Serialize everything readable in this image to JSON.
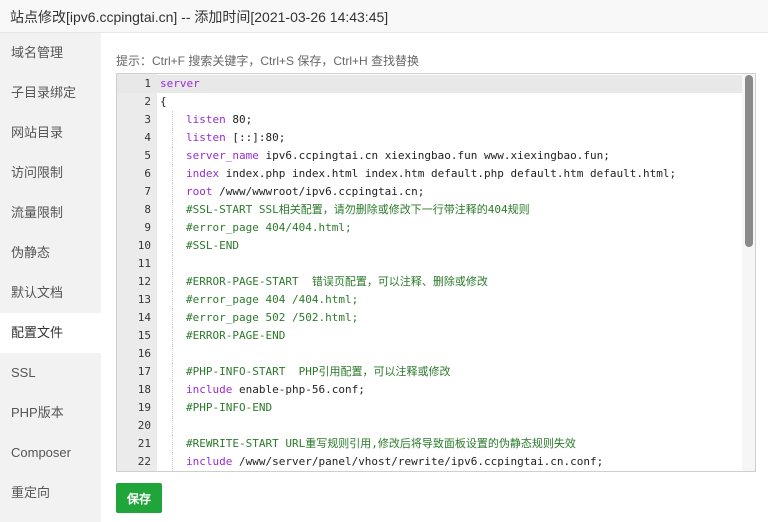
{
  "window": {
    "title": "站点修改[ipv6.ccpingtai.cn] -- 添加时间[2021-03-26 14:43:45]"
  },
  "sidebar": {
    "items": [
      {
        "label": "域名管理"
      },
      {
        "label": "子目录绑定"
      },
      {
        "label": "网站目录"
      },
      {
        "label": "访问限制"
      },
      {
        "label": "流量限制"
      },
      {
        "label": "伪静态"
      },
      {
        "label": "默认文档"
      },
      {
        "label": "配置文件",
        "active": true
      },
      {
        "label": "SSL"
      },
      {
        "label": "PHP版本"
      },
      {
        "label": "Composer"
      },
      {
        "label": "重定向"
      }
    ]
  },
  "hint": "提示：Ctrl+F 搜索关键字，Ctrl+S 保存，Ctrl+H 查找替换",
  "editor": {
    "lines": [
      {
        "n": "1",
        "indent": 0,
        "tokens": [
          {
            "t": "server",
            "c": "kw"
          }
        ]
      },
      {
        "n": "2",
        "indent": 0,
        "tokens": [
          {
            "t": "{",
            "c": "plain"
          }
        ]
      },
      {
        "n": "3",
        "indent": 1,
        "tokens": [
          {
            "t": "listen",
            "c": "kw"
          },
          {
            "t": " 80;",
            "c": "plain"
          }
        ]
      },
      {
        "n": "4",
        "indent": 1,
        "tokens": [
          {
            "t": "listen",
            "c": "kw"
          },
          {
            "t": " [::]:80;",
            "c": "plain"
          }
        ]
      },
      {
        "n": "5",
        "indent": 1,
        "tokens": [
          {
            "t": "server_name",
            "c": "kw"
          },
          {
            "t": " ipv6.ccpingtai.cn xiexingbao.fun www.xiexingbao.fun;",
            "c": "plain"
          }
        ]
      },
      {
        "n": "6",
        "indent": 1,
        "tokens": [
          {
            "t": "index",
            "c": "kw"
          },
          {
            "t": " index.php index.html index.htm default.php default.htm default.html;",
            "c": "plain"
          }
        ]
      },
      {
        "n": "7",
        "indent": 1,
        "tokens": [
          {
            "t": "root",
            "c": "kw"
          },
          {
            "t": " /www/wwwroot/ipv6.ccpingtai.cn;",
            "c": "plain"
          }
        ]
      },
      {
        "n": "8",
        "indent": 1,
        "tokens": [
          {
            "t": "#SSL-START SSL相关配置，请勿删除或修改下一行带注释的404规则",
            "c": "comment"
          }
        ]
      },
      {
        "n": "9",
        "indent": 1,
        "tokens": [
          {
            "t": "#error_page 404/404.html;",
            "c": "comment"
          }
        ]
      },
      {
        "n": "10",
        "indent": 1,
        "tokens": [
          {
            "t": "#SSL-END",
            "c": "comment"
          }
        ]
      },
      {
        "n": "11",
        "indent": 1,
        "tokens": []
      },
      {
        "n": "12",
        "indent": 1,
        "tokens": [
          {
            "t": "#ERROR-PAGE-START  错误页配置，可以注释、删除或修改",
            "c": "comment"
          }
        ]
      },
      {
        "n": "13",
        "indent": 1,
        "tokens": [
          {
            "t": "#error_page 404 /404.html;",
            "c": "comment"
          }
        ]
      },
      {
        "n": "14",
        "indent": 1,
        "tokens": [
          {
            "t": "#error_page 502 /502.html;",
            "c": "comment"
          }
        ]
      },
      {
        "n": "15",
        "indent": 1,
        "tokens": [
          {
            "t": "#ERROR-PAGE-END",
            "c": "comment"
          }
        ]
      },
      {
        "n": "16",
        "indent": 1,
        "tokens": []
      },
      {
        "n": "17",
        "indent": 1,
        "tokens": [
          {
            "t": "#PHP-INFO-START  PHP引用配置，可以注释或修改",
            "c": "comment"
          }
        ]
      },
      {
        "n": "18",
        "indent": 1,
        "tokens": [
          {
            "t": "include",
            "c": "kw"
          },
          {
            "t": " enable-php-56.conf;",
            "c": "plain"
          }
        ]
      },
      {
        "n": "19",
        "indent": 1,
        "tokens": [
          {
            "t": "#PHP-INFO-END",
            "c": "comment"
          }
        ]
      },
      {
        "n": "20",
        "indent": 1,
        "tokens": []
      },
      {
        "n": "21",
        "indent": 1,
        "tokens": [
          {
            "t": "#REWRITE-START URL重写规则引用,修改后将导致面板设置的伪静态规则失效",
            "c": "comment"
          }
        ]
      },
      {
        "n": "22",
        "indent": 1,
        "tokens": [
          {
            "t": "include",
            "c": "kw"
          },
          {
            "t": " /www/server/panel/vhost/rewrite/ipv6.ccpingtai.cn.conf;",
            "c": "plain"
          }
        ]
      }
    ],
    "current_line": "1"
  },
  "save_button": {
    "label": "保存"
  }
}
